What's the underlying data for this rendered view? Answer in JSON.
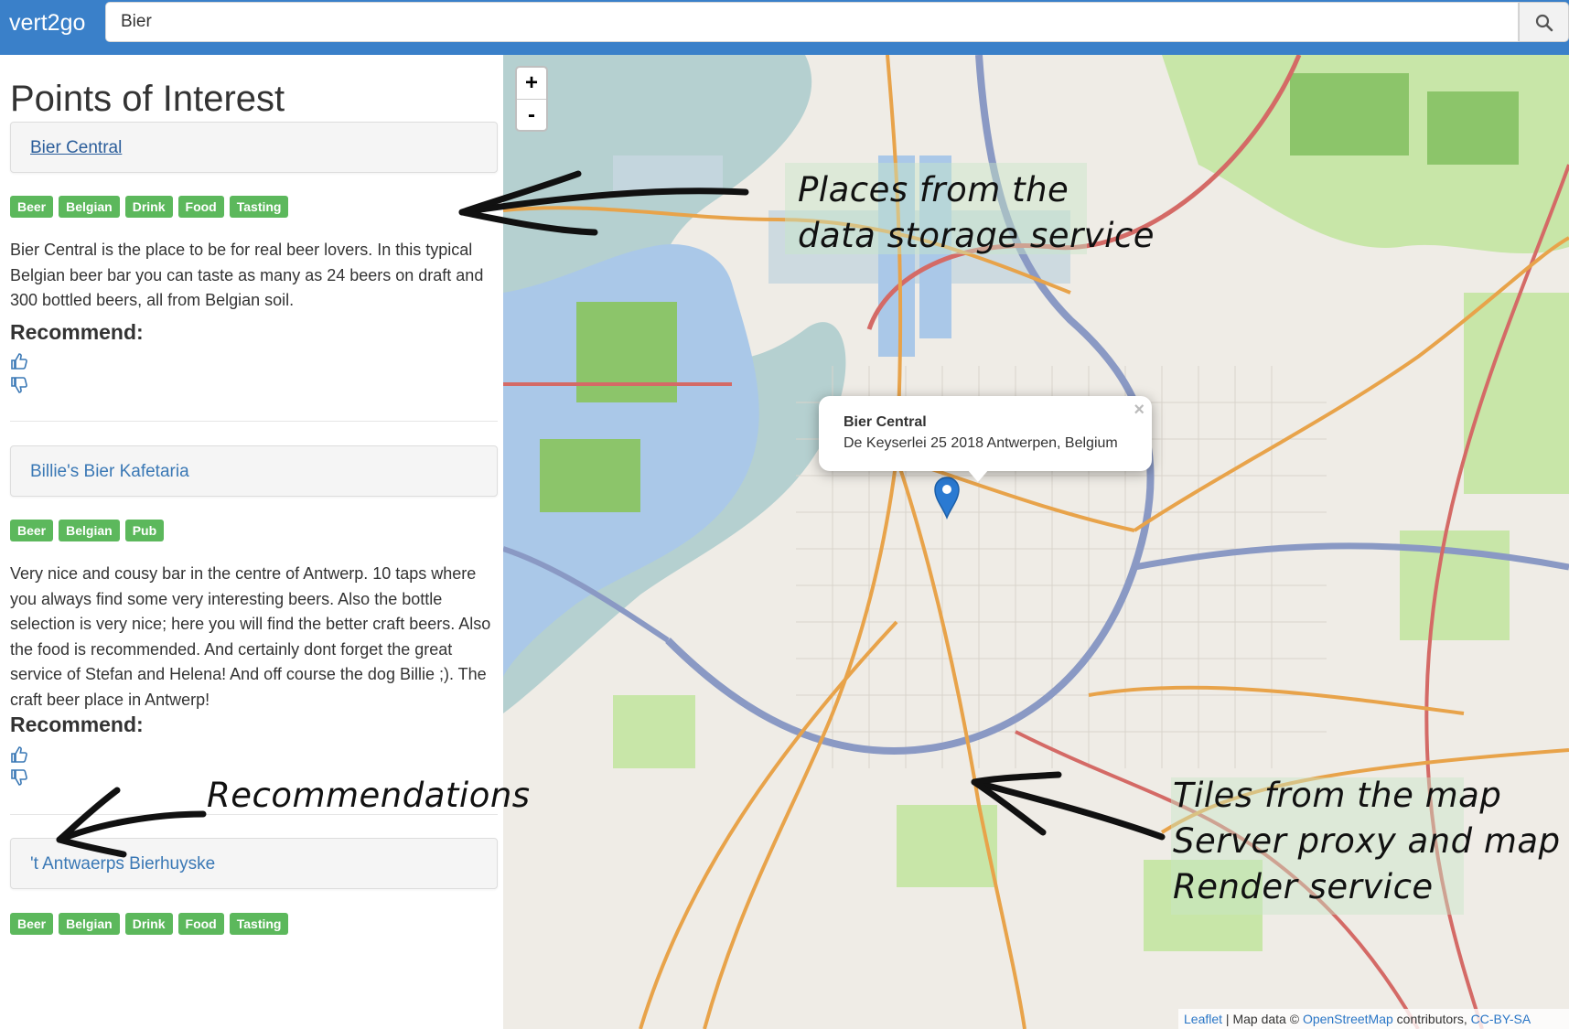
{
  "header": {
    "brand": "vert2go",
    "search_value": "Bier",
    "search_button_icon": "search-icon"
  },
  "sidebar": {
    "title": "Points of Interest",
    "recommend_label": "Recommend:",
    "pois": [
      {
        "name": "Bier Central",
        "tags": [
          "Beer",
          "Belgian",
          "Drink",
          "Food",
          "Tasting"
        ],
        "description": "Bier Central is the place to be for real beer lovers. In this typical Belgian beer bar you can taste as many as 24 beers on draft and 300 bottled beers, all from Belgian soil."
      },
      {
        "name": "Billie's Bier Kafetaria",
        "tags": [
          "Beer",
          "Belgian",
          "Pub"
        ],
        "description": "Very nice and cousy bar in the centre of Antwerp. 10 taps where you always find some very interesting beers. Also the bottle selection is very nice; here you will find the better craft beers. Also the food is recommended. And certainly dont forget the great service of Stefan and Helena! And off course the dog Billie ;). The craft beer place in Antwerp!"
      },
      {
        "name": "'t Antwaerps Bierhuyske",
        "tags": [
          "Beer",
          "Belgian",
          "Drink",
          "Food",
          "Tasting"
        ]
      }
    ]
  },
  "map": {
    "zoom_in": "+",
    "zoom_out": "-",
    "popup_title": "Bier Central",
    "popup_address": "De Keyserlei 25 2018 Antwerpen, Belgium",
    "popup_close": "×",
    "attribution": {
      "leaflet": "Leaflet",
      "sep": " | Map data © ",
      "osm": "OpenStreetMap",
      "contrib": " contributors, ",
      "license": "CC-BY-SA"
    },
    "colors": {
      "water": "#b5d0d0",
      "park": "#c8e6a8",
      "forest": "#8cc56a",
      "major_road": "#e8a34a",
      "motorway": "#d46a66",
      "ring": "#8a99c4"
    }
  },
  "annotations": {
    "places_line1": "Places from the",
    "places_line2": "data storage service",
    "recommendations": "Recommendations",
    "tiles_line1": "Tiles from the map",
    "tiles_line2": "Server proxy and map",
    "tiles_line3": "Render service"
  }
}
